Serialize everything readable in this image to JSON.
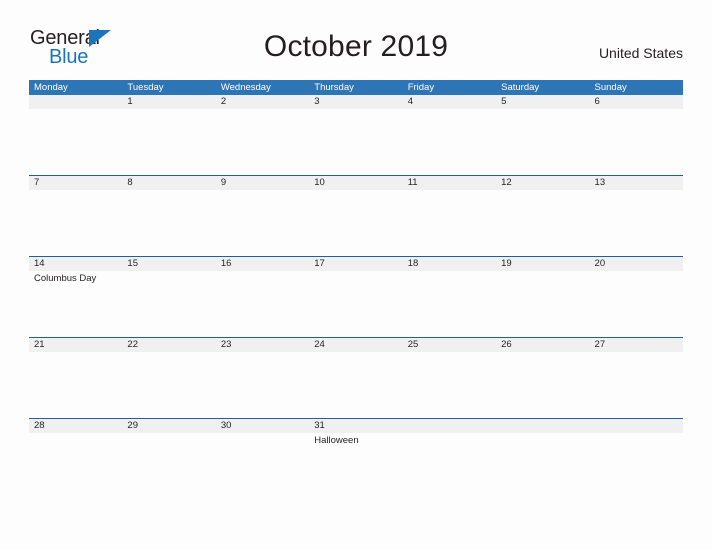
{
  "branding": {
    "logo_line1": "General",
    "logo_line2": "Blue",
    "logo_triangle_color": "#1b75bb",
    "logo_line1_color": "#231f20",
    "logo_line2_color": "#1b75bb"
  },
  "header": {
    "title": "October 2019",
    "region": "United States"
  },
  "colors": {
    "weekday_header_bg": "#2e75b6",
    "weekday_header_text": "#ffffff",
    "week_rule": "#1f5f9e",
    "day_strip_bg": "#f0f0f0",
    "page_bg": "#fdfdfd",
    "text": "#231f20"
  },
  "calendar": {
    "month": "October",
    "year": "2019",
    "weekday_headers": [
      "Monday",
      "Tuesday",
      "Wednesday",
      "Thursday",
      "Friday",
      "Saturday",
      "Sunday"
    ],
    "weeks": [
      {
        "days": [
          {
            "number": "",
            "events": []
          },
          {
            "number": "1",
            "events": []
          },
          {
            "number": "2",
            "events": []
          },
          {
            "number": "3",
            "events": []
          },
          {
            "number": "4",
            "events": []
          },
          {
            "number": "5",
            "events": []
          },
          {
            "number": "6",
            "events": []
          }
        ]
      },
      {
        "days": [
          {
            "number": "7",
            "events": []
          },
          {
            "number": "8",
            "events": []
          },
          {
            "number": "9",
            "events": []
          },
          {
            "number": "10",
            "events": []
          },
          {
            "number": "11",
            "events": []
          },
          {
            "number": "12",
            "events": []
          },
          {
            "number": "13",
            "events": []
          }
        ]
      },
      {
        "days": [
          {
            "number": "14",
            "events": [
              "Columbus Day"
            ]
          },
          {
            "number": "15",
            "events": []
          },
          {
            "number": "16",
            "events": []
          },
          {
            "number": "17",
            "events": []
          },
          {
            "number": "18",
            "events": []
          },
          {
            "number": "19",
            "events": []
          },
          {
            "number": "20",
            "events": []
          }
        ]
      },
      {
        "days": [
          {
            "number": "21",
            "events": []
          },
          {
            "number": "22",
            "events": []
          },
          {
            "number": "23",
            "events": []
          },
          {
            "number": "24",
            "events": []
          },
          {
            "number": "25",
            "events": []
          },
          {
            "number": "26",
            "events": []
          },
          {
            "number": "27",
            "events": []
          }
        ]
      },
      {
        "days": [
          {
            "number": "28",
            "events": []
          },
          {
            "number": "29",
            "events": []
          },
          {
            "number": "30",
            "events": []
          },
          {
            "number": "31",
            "events": [
              "Halloween"
            ]
          },
          {
            "number": "",
            "events": []
          },
          {
            "number": "",
            "events": []
          },
          {
            "number": "",
            "events": []
          }
        ]
      }
    ]
  }
}
